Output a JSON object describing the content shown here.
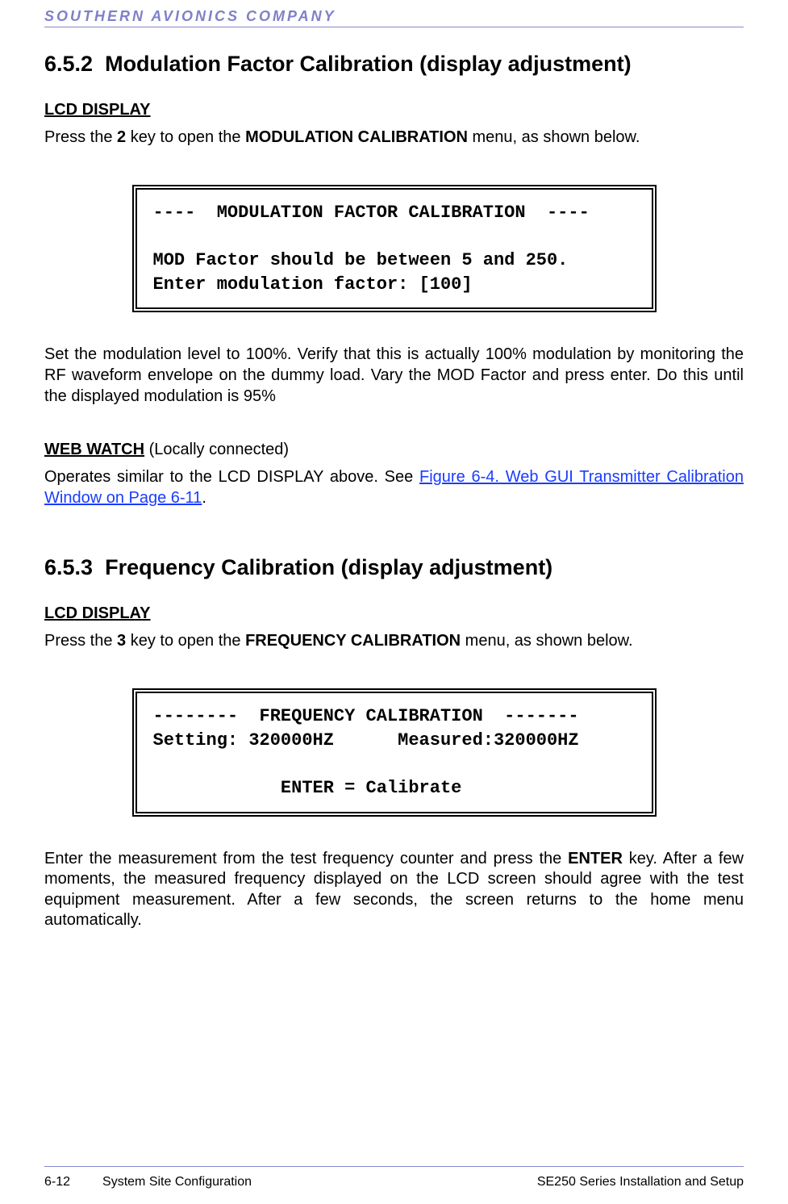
{
  "header": {
    "brand": "SOUTHERN AVIONICS COMPANY"
  },
  "section1": {
    "number": "6.5.2",
    "title": "Modulation Factor Calibration (display adjustment)",
    "lcd_label": "LCD DISPLAY",
    "intro_prefix": "Press the ",
    "intro_key": "2",
    "intro_mid": " key to open the ",
    "intro_menu": "MODULATION CALIBRATION",
    "intro_suffix": " menu, as shown below.",
    "lcd_text": "----  MODULATION FACTOR CALIBRATION  ----\n\nMOD Factor should be between 5 and 250.\nEnter modulation factor: [100]",
    "after_box": "Set the modulation level to 100%.  Verify that this is actually 100% modulation by monitoring the RF waveform envelope on the dummy load.   Vary the MOD Factor and press enter.  Do this until the displayed modulation is 95%",
    "webwatch_label": "WEB WATCH",
    "webwatch_annot": "  (Locally connected)",
    "webwatch_para_prefix": "Operates similar to the LCD DISPLAY above.  See ",
    "webwatch_link": "Figure 6-4.  Web GUI Transmitter Calibration Window on Page  6-11",
    "webwatch_para_suffix": "."
  },
  "section2": {
    "number": "6.5.3",
    "title": "Frequency Calibration (display adjustment)",
    "lcd_label": "LCD DISPLAY",
    "intro_prefix": "Press the ",
    "intro_key": "3",
    "intro_mid": " key to open the ",
    "intro_menu": "FREQUENCY CALIBRATION",
    "intro_suffix": " menu, as shown below.",
    "lcd_text": "--------  FREQUENCY CALIBRATION  -------\nSetting: 320000HZ      Measured:320000HZ\n\n            ENTER = Calibrate",
    "after_box_prefix": "Enter the measurement from the test frequency counter and press the ",
    "after_box_key": "ENTER",
    "after_box_suffix": " key.  After a few moments, the measured frequency displayed on the LCD screen should agree with the test equipment measurement. After a few seconds, the screen returns to the home menu automatically."
  },
  "footer": {
    "page_num": "6-12",
    "section": "System Site Configuration",
    "doc": "SE250 Series Installation and Setup"
  }
}
